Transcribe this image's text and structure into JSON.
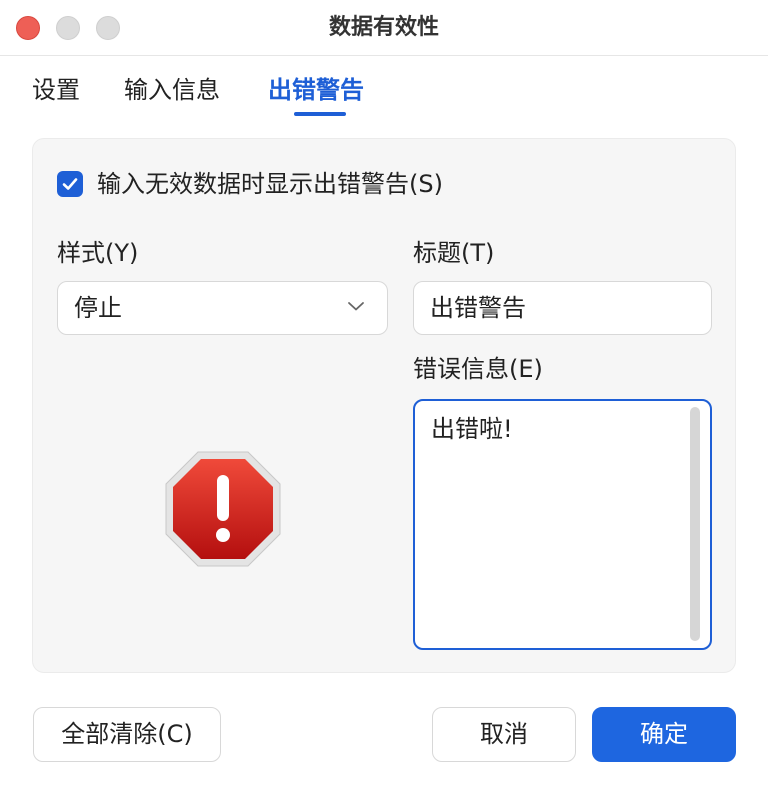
{
  "window": {
    "title": "数据有效性"
  },
  "tabs": [
    {
      "label": "设置",
      "active": false
    },
    {
      "label": "输入信息",
      "active": false
    },
    {
      "label": "出错警告",
      "active": true
    }
  ],
  "panel": {
    "show_alert_checkbox": {
      "label": "输入无效数据时显示出错警告(S)",
      "checked": true
    },
    "style": {
      "label": "样式(Y)",
      "selected": "停止"
    },
    "title": {
      "label": "标题(T)",
      "value": "出错警告"
    },
    "error_message": {
      "label": "错误信息(E)",
      "value": "出错啦!"
    },
    "icon": "stop-error-icon"
  },
  "buttons": {
    "clear_all": "全部清除(C)",
    "cancel": "取消",
    "ok": "确定"
  },
  "colors": {
    "accent": "#1e5fd6",
    "stop_red": "#d81e1e"
  }
}
